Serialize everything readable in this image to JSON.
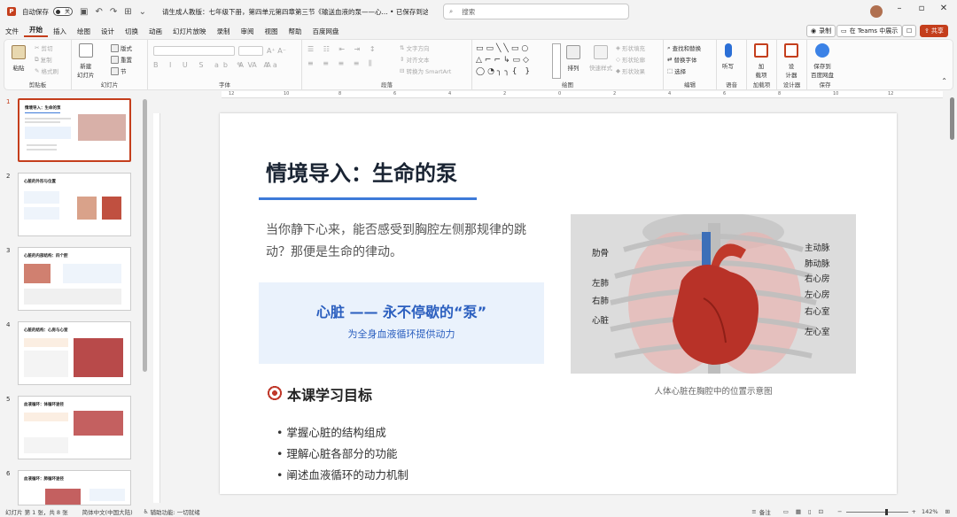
{
  "titlebar": {
    "app_icon": "powerpoint-icon",
    "autosave_label": "自动保存",
    "autosave_state": "关",
    "doc_title": "请生成人教版：七年级下册，第四单元第四章第三节《输送血液的泵——心... • 已保存到这台电脑",
    "search_placeholder": "搜索"
  },
  "menu": {
    "items": [
      "文件",
      "开始",
      "插入",
      "绘图",
      "设计",
      "切换",
      "动画",
      "幻灯片放映",
      "录制",
      "审阅",
      "视图",
      "帮助",
      "百度网盘"
    ],
    "active": "开始",
    "record_label": "录制",
    "teams_label": "在 Teams 中展示",
    "share_label": "共享"
  },
  "ribbon": {
    "groups": {
      "clipboard": "剪贴板",
      "slides": "幻灯片",
      "font": "字体",
      "paragraph": "段落",
      "drawing": "绘图",
      "editing": "编辑",
      "voice": "语音",
      "addins": "加载项",
      "designer": "设计器",
      "save": "保存"
    },
    "paste": "粘贴",
    "cut": "剪切",
    "copy": "复制",
    "format_painter": "格式刷",
    "new_slide": "新建\n幻灯片",
    "layout": "版式",
    "reset": "重置",
    "section": "节",
    "text_direction": "文字方向",
    "align_text": "对齐文本",
    "smartart": "转换为 SmartArt",
    "arrange": "排列",
    "quick_styles": "快速样式",
    "shape_fill": "形状填充",
    "shape_outline": "形状轮廓",
    "shape_effects": "形状效果",
    "find_replace": "查找和替换",
    "replace_font": "替换字体",
    "select": "选择",
    "dictate": "听写",
    "addins_btn": "加\n载项",
    "designer_btn": "设\n计器",
    "save_baidu": "保存到\n百度网盘"
  },
  "ruler_marks": [
    "12",
    "10",
    "8",
    "6",
    "4",
    "2",
    "0",
    "2",
    "4",
    "6",
    "8",
    "10",
    "12"
  ],
  "slides": [
    {
      "num": "1",
      "title": "情境导入：生命的泵"
    },
    {
      "num": "2",
      "title": "心脏的外形与位置"
    },
    {
      "num": "3",
      "title": "心脏的内部结构：四个腔"
    },
    {
      "num": "4",
      "title": "心脏的结构：心房与心室"
    },
    {
      "num": "5",
      "title": "血液循环：体循环途径"
    },
    {
      "num": "6",
      "title": "血液循环：肺循环途径"
    }
  ],
  "slide": {
    "title": "情境导入：生命的泵",
    "intro": "当你静下心来，能否感受到胸腔左侧那规律的跳动？那便是生命的律动。",
    "callout_title": "心脏 —— 永不停歇的“泵”",
    "callout_sub": "为全身血液循环提供动力",
    "goals_title": "本课学习目标",
    "goals": [
      "• 掌握心脏的结构组成",
      "• 理解心脏各部分的功能",
      "• 阐述血液循环的动力机制"
    ],
    "caption": "人体心脏在胸腔中的位置示意图",
    "left_labels": [
      "肋骨",
      "左肺",
      "右肺",
      "心脏"
    ],
    "right_labels": [
      "主动脉",
      "肺动脉",
      "右心房",
      "左心房",
      "右心室",
      "左心室"
    ]
  },
  "status": {
    "slide_pos": "幻灯片 第 1 张，共 8 张",
    "language": "简体中文(中国大陆)",
    "accessibility": "辅助功能: 一切就绪",
    "notes": "备注",
    "zoom": "142%"
  },
  "colors": {
    "accent": "#c43e1c",
    "title_blue": "#3d7ad8",
    "callout_bg": "#eaf2fc"
  }
}
